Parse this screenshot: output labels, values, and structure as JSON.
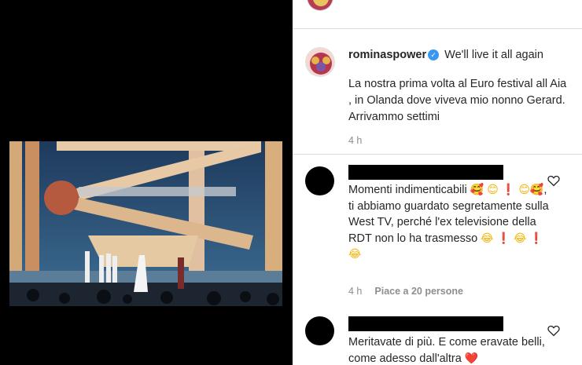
{
  "post": {
    "username": "rominaspower",
    "verified_icon": "verified-badge-icon",
    "caption_title": "We'll live it all again",
    "caption_body": "La nostra prima volta al Euro festival all Aia , in Olanda dove viveva mio nonno Gerard. Arrivammo settimi",
    "time": "4 h"
  },
  "comments": [
    {
      "text_before": "Momenti indimenticabili",
      "emoji_row1": [
        "🥰",
        "😊",
        "❗"
      ],
      "line2_emojis": [
        "😊",
        "🥰"
      ],
      "text_after": "ti abbiamo guardato segretamente sulla West TV, perché l'ex televisione della RDT non lo ha trasmesso",
      "emoji_end": [
        "😂",
        "❗",
        "😂",
        "❗",
        "😂"
      ],
      "time": "4 h",
      "likes": "Piace a 20 persone"
    },
    {
      "text": "Meritavate di più. E come eravate belli, come adesso dall'altra",
      "emoji_end": [
        "❤️"
      ]
    }
  ],
  "colors": {
    "accent": "#3897f0",
    "text": "#262626",
    "muted": "#8e8e8e"
  }
}
